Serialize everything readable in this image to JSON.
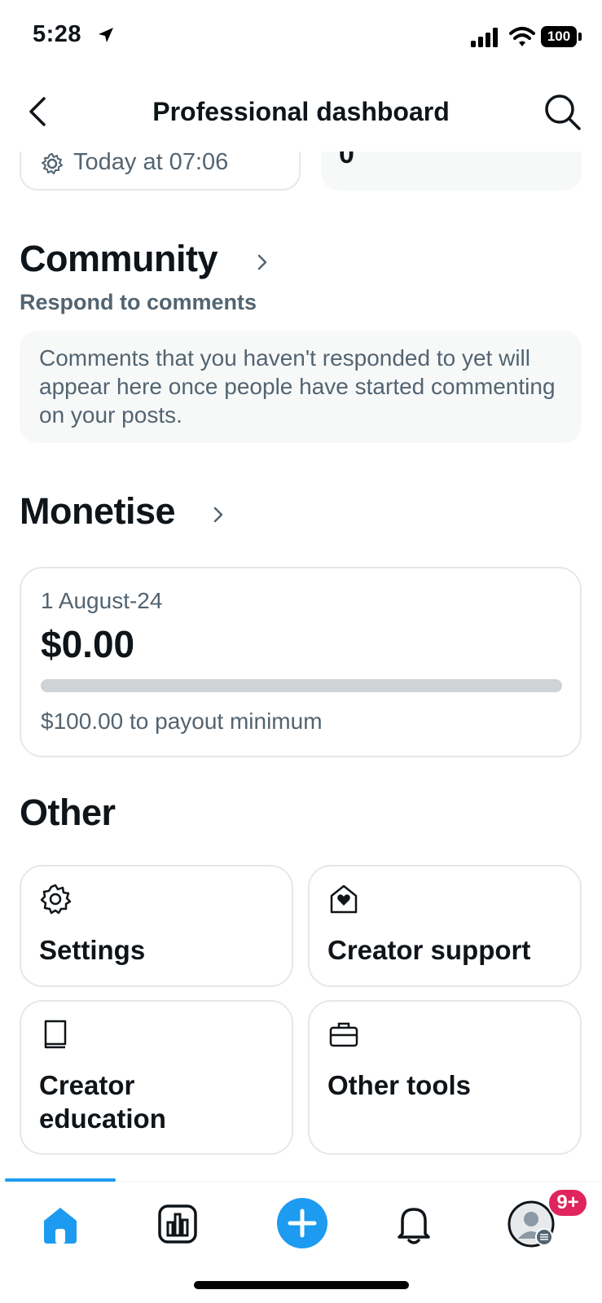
{
  "status_bar": {
    "time": "5:28",
    "battery": "100",
    "icons": [
      "location-arrow-icon",
      "signal-icon",
      "wifi-icon",
      "battery-icon"
    ]
  },
  "header": {
    "title": "Professional dashboard",
    "icons": [
      "back-icon",
      "search-icon"
    ]
  },
  "top_cards": {
    "left_text": "Today at 07:06",
    "right_value": "0"
  },
  "community": {
    "title": "Community",
    "subtitle": "Respond to comments",
    "empty_text": "Comments that you haven't responded to yet will appear here once people have started commenting on your posts."
  },
  "monetise": {
    "title": "Monetise",
    "date": "1 August-24",
    "amount": "$0.00",
    "progress": 0,
    "note": "$100.00 to payout minimum"
  },
  "other": {
    "title": "Other",
    "tiles": [
      {
        "label": "Settings",
        "icon": "gear-icon"
      },
      {
        "label": "Creator support",
        "icon": "heart-house-icon"
      },
      {
        "label": "Creator education",
        "icon": "book-icon"
      },
      {
        "label": "Other tools",
        "icon": "toolbox-icon"
      }
    ]
  },
  "tab_bar": {
    "tabs": [
      "home-icon",
      "analytics-icon",
      "compose-icon",
      "bell-icon",
      "profile-avatar"
    ],
    "badge": "9+"
  },
  "colors": {
    "accent": "#1d9bf0",
    "secondary_text": "#536471",
    "badge": "#e0245e"
  }
}
